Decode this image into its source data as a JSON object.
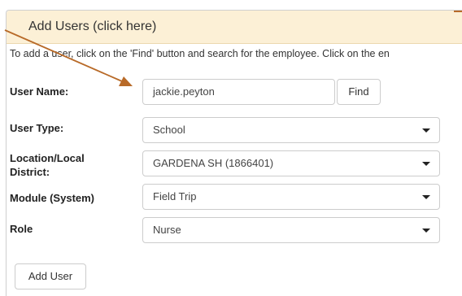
{
  "panel": {
    "title": "Add Users (click here)",
    "instructions": "To add a user, click on the 'Find' button and search for the employee. Click on the en"
  },
  "form": {
    "user_name": {
      "label": "User Name:",
      "value": "jackie.peyton"
    },
    "find_button": "Find",
    "user_type": {
      "label": "User Type:",
      "value": "School"
    },
    "location": {
      "label_line1": "Location/Local",
      "label_line2": "District:",
      "value": "GARDENA SH (1866401)"
    },
    "module": {
      "label": "Module (System)",
      "value": "Field Trip"
    },
    "role": {
      "label": "Role",
      "value": "Nurse"
    },
    "add_user_button": "Add User"
  },
  "annotation": {
    "arrow_color": "#b86a28"
  }
}
